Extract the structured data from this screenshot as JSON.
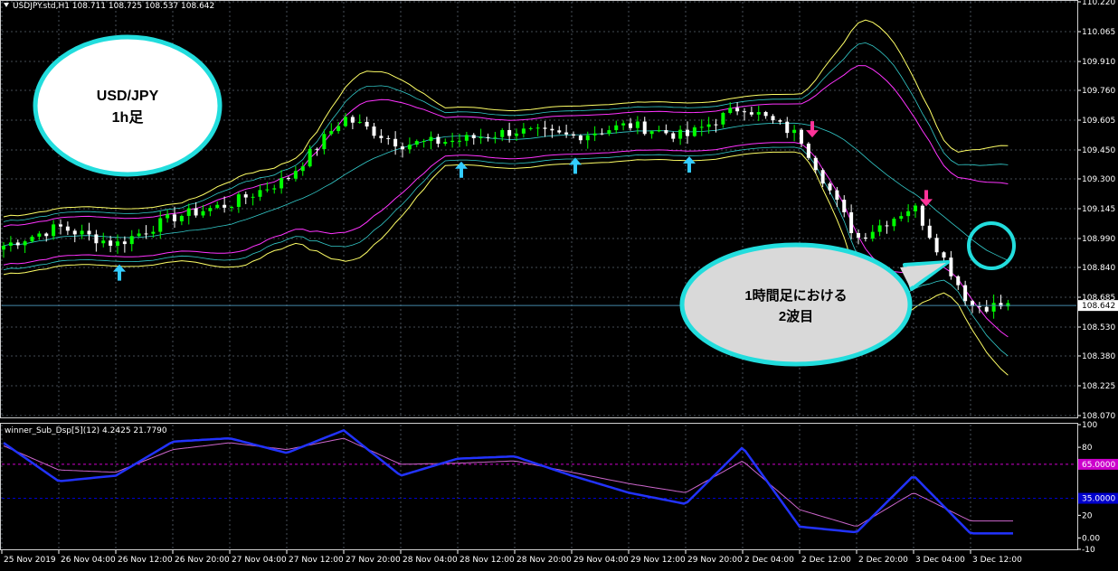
{
  "header": {
    "symbol_info": "USDJPY.std,H1  108.711 108.725 108.537 108.642",
    "indicator_info": "winner_Sub_Dsp[5](12) 4.2425 21.7790"
  },
  "callouts": {
    "top_left": {
      "line1": "USD/JPY",
      "line2": "1h足"
    },
    "bottom_right": {
      "line1": "1時間足における",
      "line2": "2波目"
    }
  },
  "colors": {
    "background": "#000000",
    "grid": "#5a6470",
    "bull_candle": "#00ff00",
    "bear_candle": "#ffffff",
    "band_outer": "#ffff66",
    "band_mid": "#ff33ff",
    "band_center": "#33cccc",
    "up_arrow": "#33ccff",
    "down_arrow": "#ff3399",
    "osc_main": "#2233ff",
    "osc_signal": "#cc66cc",
    "level_65": "#cc00cc",
    "level_35": "#0000cc",
    "callout_border": "#22dddd",
    "current_price_line": "#4488aa"
  },
  "chart_data": [
    {
      "type": "candlestick",
      "symbol": "USDJPY.std",
      "timeframe": "H1",
      "ylim": [
        108.07,
        110.22
      ],
      "y_ticks": [
        "110.220",
        "110.065",
        "109.910",
        "109.760",
        "109.605",
        "109.450",
        "109.300",
        "109.145",
        "108.990",
        "108.840",
        "108.685",
        "108.530",
        "108.380",
        "108.225",
        "108.070"
      ],
      "x_ticks": [
        "25 Nov 2019",
        "26 Nov 04:00",
        "26 Nov 12:00",
        "26 Nov 20:00",
        "27 Nov 04:00",
        "27 Nov 12:00",
        "27 Nov 20:00",
        "28 Nov 04:00",
        "28 Nov 12:00",
        "28 Nov 20:00",
        "29 Nov 04:00",
        "29 Nov 12:00",
        "29 Nov 20:00",
        "2 Dec 04:00",
        "2 Dec 12:00",
        "2 Dec 20:00",
        "3 Dec 04:00",
        "3 Dec 12:00"
      ],
      "current_price": "108.642",
      "up_arrow_labels": [
        "26 Nov 12:00",
        "28 Nov 12:00",
        "29 Nov 04:00",
        "29 Nov 20:00"
      ],
      "down_arrow_labels": [
        "2 Dec 12:00",
        "3 Dec 04:00"
      ],
      "close_anchors": [
        [
          "25 Nov 2019",
          108.95
        ],
        [
          "26 Nov 04:00",
          109.05
        ],
        [
          "26 Nov 12:00",
          108.96
        ],
        [
          "26 Nov 20:00",
          109.1
        ],
        [
          "27 Nov 04:00",
          109.17
        ],
        [
          "27 Nov 12:00",
          109.3
        ],
        [
          "27 Nov 20:00",
          109.62
        ],
        [
          "28 Nov 04:00",
          109.48
        ],
        [
          "28 Nov 12:00",
          109.5
        ],
        [
          "28 Nov 20:00",
          109.55
        ],
        [
          "29 Nov 04:00",
          109.52
        ],
        [
          "29 Nov 12:00",
          109.58
        ],
        [
          "29 Nov 20:00",
          109.52
        ],
        [
          "2 Dec 04:00",
          109.68
        ],
        [
          "2 Dec 12:00",
          109.52
        ],
        [
          "2 Dec 20:00",
          108.99
        ],
        [
          "3 Dec 04:00",
          109.16
        ],
        [
          "3 Dec 12:00",
          108.64
        ]
      ]
    },
    {
      "type": "line",
      "name": "winner_Sub_Dsp",
      "ylim": [
        -10,
        100
      ],
      "y_ticks": [
        "100",
        "80",
        "20",
        "0.00",
        "-10"
      ],
      "levels": [
        {
          "value": 65,
          "label": "65.0000"
        },
        {
          "value": 35,
          "label": "35.0000"
        }
      ],
      "main_anchors": [
        [
          "25 Nov 2019",
          85
        ],
        [
          "26 Nov 04:00",
          50
        ],
        [
          "26 Nov 12:00",
          55
        ],
        [
          "26 Nov 20:00",
          85
        ],
        [
          "27 Nov 04:00",
          88
        ],
        [
          "27 Nov 12:00",
          75
        ],
        [
          "27 Nov 20:00",
          95
        ],
        [
          "28 Nov 04:00",
          55
        ],
        [
          "28 Nov 12:00",
          70
        ],
        [
          "28 Nov 20:00",
          72
        ],
        [
          "29 Nov 04:00",
          55
        ],
        [
          "29 Nov 12:00",
          40
        ],
        [
          "29 Nov 20:00",
          30
        ],
        [
          "2 Dec 04:00",
          80
        ],
        [
          "2 Dec 12:00",
          10
        ],
        [
          "2 Dec 20:00",
          5
        ],
        [
          "3 Dec 04:00",
          55
        ],
        [
          "3 Dec 12:00",
          4
        ]
      ],
      "signal_anchors": [
        [
          "25 Nov 2019",
          82
        ],
        [
          "26 Nov 04:00",
          60
        ],
        [
          "26 Nov 12:00",
          58
        ],
        [
          "26 Nov 20:00",
          78
        ],
        [
          "27 Nov 04:00",
          84
        ],
        [
          "27 Nov 12:00",
          78
        ],
        [
          "27 Nov 20:00",
          88
        ],
        [
          "28 Nov 04:00",
          65
        ],
        [
          "28 Nov 12:00",
          66
        ],
        [
          "28 Nov 20:00",
          68
        ],
        [
          "29 Nov 04:00",
          58
        ],
        [
          "29 Nov 12:00",
          48
        ],
        [
          "29 Nov 20:00",
          40
        ],
        [
          "2 Dec 04:00",
          68
        ],
        [
          "2 Dec 12:00",
          25
        ],
        [
          "2 Dec 20:00",
          10
        ],
        [
          "3 Dec 04:00",
          40
        ],
        [
          "3 Dec 12:00",
          15
        ]
      ]
    }
  ]
}
